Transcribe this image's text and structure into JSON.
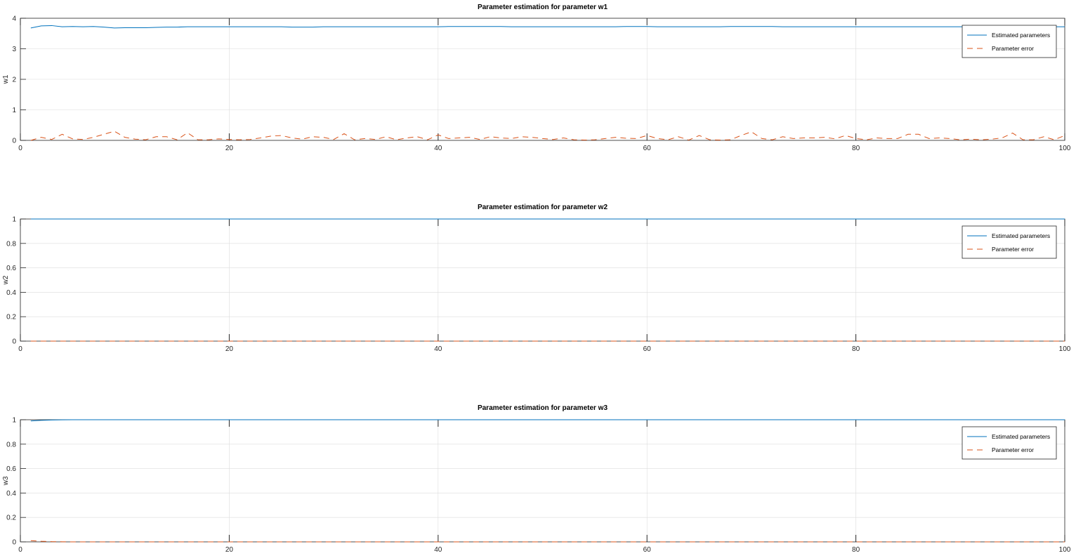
{
  "chart_data": [
    {
      "type": "line",
      "title": "Parameter estimation for parameter w1",
      "ylabel": "w1",
      "xlim": [
        0,
        100
      ],
      "ylim": [
        0,
        4
      ],
      "xticks": [
        0,
        20,
        40,
        60,
        80,
        100
      ],
      "yticks": [
        0,
        1,
        2,
        3,
        4
      ],
      "grid": true,
      "legend_position": "top-right",
      "series": [
        {
          "name": "Estimated parameters",
          "color": "#0072bd",
          "dash": "solid",
          "values": [
            3.68,
            3.75,
            3.76,
            3.72,
            3.73,
            3.72,
            3.73,
            3.71,
            3.68,
            3.69,
            3.69,
            3.69,
            3.7,
            3.71,
            3.71,
            3.72,
            3.72,
            3.72,
            3.72,
            3.72,
            3.72,
            3.72,
            3.72,
            3.72,
            3.72,
            3.71,
            3.71,
            3.71,
            3.72,
            3.72,
            3.72,
            3.72,
            3.72,
            3.72,
            3.72,
            3.72,
            3.72,
            3.72,
            3.72,
            3.72,
            3.73,
            3.73,
            3.73,
            3.73,
            3.73,
            3.73,
            3.72,
            3.72,
            3.72,
            3.72,
            3.72,
            3.72,
            3.72,
            3.72,
            3.72,
            3.72,
            3.72,
            3.73,
            3.73,
            3.73,
            3.72,
            3.72,
            3.72,
            3.72,
            3.72,
            3.72,
            3.72,
            3.73,
            3.73,
            3.73,
            3.73,
            3.73,
            3.72,
            3.72,
            3.72,
            3.72,
            3.72,
            3.72,
            3.72,
            3.72,
            3.72,
            3.72,
            3.72,
            3.72,
            3.72,
            3.72,
            3.72,
            3.72,
            3.72,
            3.72,
            3.72,
            3.72,
            3.72,
            3.72,
            3.72,
            3.72,
            3.72,
            3.72,
            3.72,
            3.72
          ]
        },
        {
          "name": "Parameter error",
          "color": "#d95319",
          "dash": "dashed",
          "values": [
            0.0,
            0.1,
            0.03,
            0.2,
            0.05,
            0.03,
            0.1,
            0.2,
            0.3,
            0.1,
            0.04,
            0.02,
            0.12,
            0.12,
            0.02,
            0.25,
            0.02,
            0.02,
            0.05,
            0.03,
            0.02,
            0.03,
            0.08,
            0.14,
            0.16,
            0.08,
            0.04,
            0.12,
            0.1,
            0.03,
            0.22,
            0.02,
            0.06,
            0.03,
            0.12,
            0.02,
            0.08,
            0.12,
            0.02,
            0.18,
            0.06,
            0.08,
            0.1,
            0.03,
            0.12,
            0.08,
            0.06,
            0.12,
            0.1,
            0.06,
            0.03,
            0.08,
            0.02,
            0.01,
            0.02,
            0.06,
            0.1,
            0.07,
            0.06,
            0.16,
            0.06,
            0.02,
            0.12,
            0.01,
            0.16,
            0.02,
            0.01,
            0.02,
            0.16,
            0.28,
            0.06,
            0.02,
            0.12,
            0.06,
            0.08,
            0.08,
            0.1,
            0.05,
            0.16,
            0.06,
            0.02,
            0.08,
            0.06,
            0.06,
            0.2,
            0.2,
            0.06,
            0.08,
            0.06,
            0.02,
            0.04,
            0.02,
            0.04,
            0.08,
            0.24,
            0.02,
            0.02,
            0.12,
            0.02,
            0.16
          ]
        }
      ]
    },
    {
      "type": "line",
      "title": "Parameter estimation for parameter w2",
      "ylabel": "w2",
      "xlim": [
        0,
        100
      ],
      "ylim": [
        0,
        1
      ],
      "xticks": [
        0,
        20,
        40,
        60,
        80,
        100
      ],
      "yticks": [
        0,
        0.2,
        0.4,
        0.6,
        0.8,
        1
      ],
      "grid": true,
      "legend_position": "top-right",
      "series": [
        {
          "name": "Estimated parameters",
          "color": "#0072bd",
          "dash": "solid",
          "values": [
            1,
            1,
            1,
            1,
            1,
            1,
            1,
            1,
            1,
            1,
            1,
            1,
            1,
            1,
            1,
            1,
            1,
            1,
            1,
            1,
            1,
            1,
            1,
            1,
            1,
            1,
            1,
            1,
            1,
            1,
            1,
            1,
            1,
            1,
            1,
            1,
            1,
            1,
            1,
            1,
            1,
            1,
            1,
            1,
            1,
            1,
            1,
            1,
            1,
            1,
            1,
            1,
            1,
            1,
            1,
            1,
            1,
            1,
            1,
            1,
            1,
            1,
            1,
            1,
            1,
            1,
            1,
            1,
            1,
            1,
            1,
            1,
            1,
            1,
            1,
            1,
            1,
            1,
            1,
            1,
            1,
            1,
            1,
            1,
            1,
            1,
            1,
            1,
            1,
            1,
            1,
            1,
            1,
            1,
            1,
            1,
            1,
            1,
            1,
            1
          ]
        },
        {
          "name": "Parameter error",
          "color": "#d95319",
          "dash": "dashed",
          "values": [
            0,
            0,
            0,
            0,
            0,
            0,
            0,
            0,
            0,
            0,
            0,
            0,
            0,
            0,
            0,
            0,
            0,
            0,
            0,
            0,
            0,
            0,
            0,
            0,
            0,
            0,
            0,
            0,
            0,
            0,
            0,
            0,
            0,
            0,
            0,
            0,
            0,
            0,
            0,
            0,
            0,
            0,
            0,
            0,
            0,
            0,
            0,
            0,
            0,
            0,
            0,
            0,
            0,
            0,
            0,
            0,
            0,
            0,
            0,
            0,
            0,
            0,
            0,
            0,
            0,
            0,
            0,
            0,
            0,
            0,
            0,
            0,
            0,
            0,
            0,
            0,
            0,
            0,
            0,
            0,
            0,
            0,
            0,
            0,
            0,
            0,
            0,
            0,
            0,
            0,
            0,
            0,
            0,
            0,
            0,
            0,
            0,
            0,
            0,
            0
          ]
        }
      ]
    },
    {
      "type": "line",
      "title": "Parameter estimation for parameter w3",
      "ylabel": "w3",
      "xlim": [
        0,
        100
      ],
      "ylim": [
        0,
        1
      ],
      "xticks": [
        0,
        20,
        40,
        60,
        80,
        100
      ],
      "yticks": [
        0,
        0.2,
        0.4,
        0.6,
        0.8,
        1
      ],
      "grid": true,
      "legend_position": "top-right",
      "series": [
        {
          "name": "Estimated parameters",
          "color": "#0072bd",
          "dash": "solid",
          "values": [
            0.99,
            0.995,
            0.998,
            0.999,
            1,
            1,
            1,
            1,
            1,
            1,
            1,
            1,
            1,
            1,
            1,
            1,
            1,
            1,
            1,
            1,
            1,
            1,
            1,
            1,
            1,
            1,
            1,
            1,
            1,
            1,
            1,
            1,
            1,
            1,
            1,
            1,
            1,
            1,
            1,
            1,
            1,
            1,
            1,
            1,
            1,
            1,
            1,
            1,
            1,
            1,
            1,
            1,
            1,
            1,
            1,
            1,
            1,
            1,
            1,
            1,
            1,
            1,
            1,
            1,
            1,
            1,
            1,
            1,
            1,
            1,
            1,
            1,
            1,
            1,
            1,
            1,
            1,
            1,
            1,
            1,
            1,
            1,
            1,
            1,
            1,
            1,
            1,
            1,
            1,
            1,
            1,
            1,
            1,
            1,
            1,
            1,
            1,
            1,
            1,
            1
          ]
        },
        {
          "name": "Parameter error",
          "color": "#d95319",
          "dash": "dashed",
          "values": [
            0.01,
            0.005,
            0.002,
            0.001,
            0,
            0,
            0,
            0,
            0,
            0,
            0,
            0,
            0,
            0,
            0,
            0,
            0,
            0,
            0,
            0,
            0,
            0,
            0,
            0,
            0,
            0,
            0,
            0,
            0,
            0,
            0,
            0,
            0,
            0,
            0,
            0,
            0,
            0,
            0,
            0,
            0,
            0,
            0,
            0,
            0,
            0,
            0,
            0,
            0,
            0,
            0,
            0,
            0,
            0,
            0,
            0,
            0,
            0,
            0,
            0,
            0,
            0,
            0,
            0,
            0,
            0,
            0,
            0,
            0,
            0,
            0,
            0,
            0,
            0,
            0,
            0,
            0,
            0,
            0,
            0,
            0,
            0,
            0,
            0,
            0,
            0,
            0,
            0,
            0,
            0,
            0,
            0,
            0,
            0,
            0,
            0,
            0,
            0,
            0,
            0
          ]
        }
      ]
    }
  ]
}
